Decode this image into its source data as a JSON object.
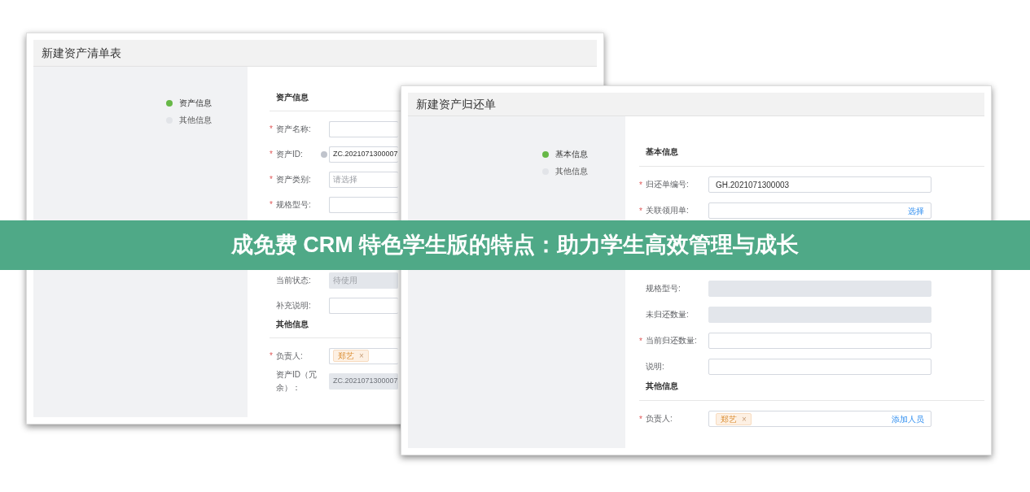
{
  "windows": [
    {
      "title": "新建资产清单表",
      "steps": [
        {
          "label": "资产信息",
          "selected": true
        },
        {
          "label": "其他信息",
          "selected": false
        }
      ],
      "sections": [
        {
          "heading": "资产信息",
          "fields": [
            {
              "mark": "*",
              "label": "资产名称:",
              "disabled": false
            },
            {
              "mark": "*",
              "label": "资产ID:",
              "help": true,
              "value": "ZC.2021071300007",
              "disabled": false
            },
            {
              "mark": "*",
              "label": "资产类别:",
              "placeholder": "请选择",
              "disabled": false
            },
            {
              "mark": "*",
              "label": "规格型号:",
              "disabled": false
            }
          ]
        },
        {
          "fields": [
            {
              "label": "当前状态:",
              "placeholder": "待使用",
              "disabled": true
            },
            {
              "label": "补充说明:",
              "disabled": false
            }
          ]
        },
        {
          "heading": "其他信息",
          "fields": [
            {
              "mark": "*",
              "label": "负责人:",
              "disabled": false,
              "tags": [
                {
                  "name": "郑艺",
                  "close": "×"
                }
              ]
            },
            {
              "label": "资产ID（冗余）：",
              "value": "ZC.2021071300007",
              "disabled": true
            }
          ]
        }
      ]
    },
    {
      "title": "新建资产归还单",
      "steps": [
        {
          "label": "基本信息",
          "selected": true
        },
        {
          "label": "其他信息",
          "selected": false
        }
      ],
      "sections": [
        {
          "heading": "基本信息",
          "fields": [
            {
              "mark": "*",
              "label": "归还单编号:",
              "value": "GH.2021071300003",
              "disabled": false
            },
            {
              "mark": "*",
              "label": "关联领用单:",
              "disabled": false,
              "action": "选择"
            }
          ]
        },
        {
          "fields": [
            {
              "label": "规格型号:",
              "disabled": true
            },
            {
              "label": "未归还数量:",
              "disabled": true
            },
            {
              "mark": "*",
              "label": "当前归还数量:",
              "disabled": false
            },
            {
              "label": "说明:",
              "disabled": false
            }
          ]
        },
        {
          "heading": "其他信息",
          "fields": [
            {
              "mark": "*",
              "label": "负责人:",
              "disabled": false,
              "tags": [
                {
                  "name": "郑艺",
                  "close": "×"
                }
              ],
              "action": "添加人员"
            }
          ]
        }
      ]
    }
  ],
  "banner": {
    "text": "成免费 CRM 特色学生版的特点：助力学生高效管理与成长"
  }
}
